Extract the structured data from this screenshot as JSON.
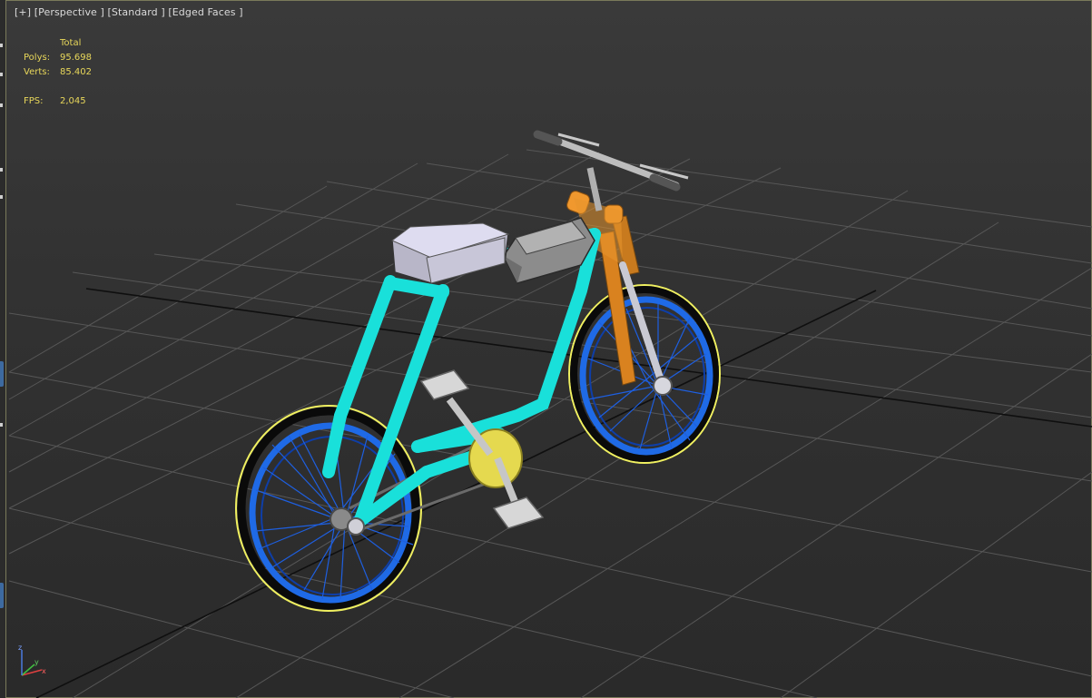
{
  "viewport": {
    "label": {
      "plus": "[+]",
      "view": "[Perspective ]",
      "shading": "[Standard ]",
      "display": "[Edged Faces ]"
    },
    "stats": {
      "total_header": "Total",
      "polys_label": "Polys:",
      "polys_value": "95.698",
      "verts_label": "Verts:",
      "verts_value": "85.402",
      "fps_label": "FPS:",
      "fps_value": "2,045"
    },
    "axis": {
      "x": "x",
      "y": "y",
      "z": "z"
    }
  },
  "colors": {
    "frame": "#26e8e0",
    "rims": "#1a5fe0",
    "fork": "#e8962e",
    "stats_text": "#e8d75a",
    "grid": "#5a5a5a",
    "grid_main": "#111111",
    "selection": "#f0f060"
  }
}
